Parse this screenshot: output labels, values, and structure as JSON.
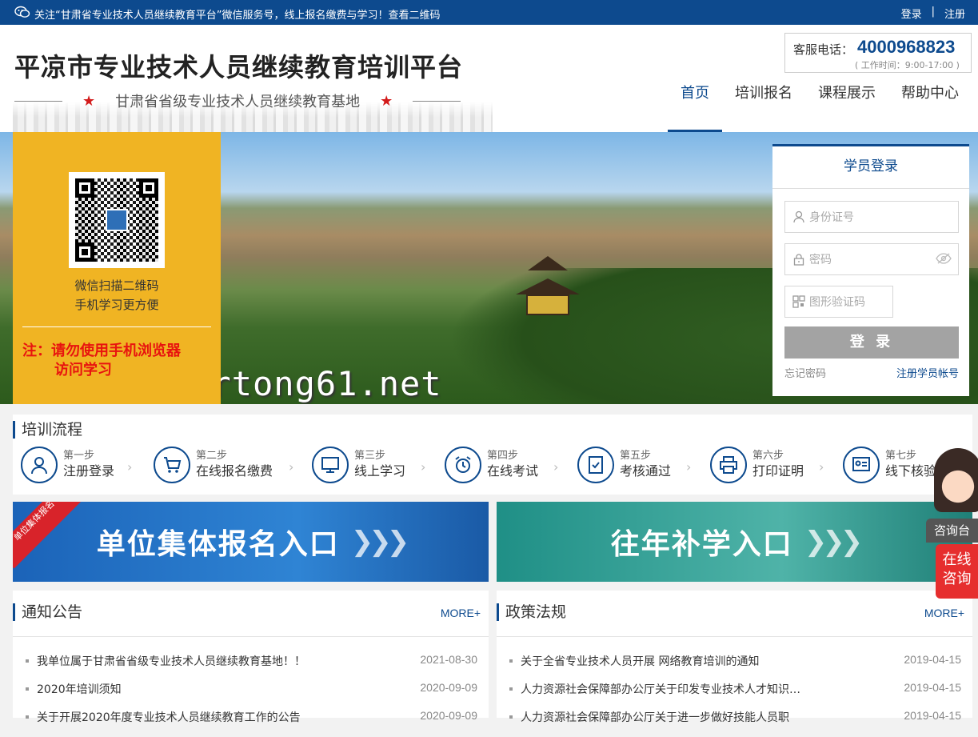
{
  "topbar": {
    "notice": "关注“甘肃省专业技术人员继续教育平台”微信服务号，线上报名缴费与学习！查看二维码",
    "login": "登录",
    "separator": "|",
    "register": "注册"
  },
  "header": {
    "title": "平凉市专业技术人员继续教育培训平台",
    "subtitle": "甘肃省省级专业技术人员继续教育基地",
    "service_label": "客服电话：",
    "service_phone": "4000968823",
    "service_hours": "( 工作时间：9:00-17:00 )"
  },
  "nav": [
    {
      "label": "首页",
      "active": true
    },
    {
      "label": "培训报名",
      "active": false
    },
    {
      "label": "课程展示",
      "active": false
    },
    {
      "label": "帮助中心",
      "active": false
    }
  ],
  "qr_panel": {
    "line1": "微信扫描二维码",
    "line2": "手机学习更方便",
    "warn1": "注：请勿使用手机浏览器",
    "warn2": "访问学习"
  },
  "watermark": "www.ertong61.net",
  "login": {
    "title": "学员登录",
    "id_placeholder": "身份证号",
    "password_placeholder": "密码",
    "captcha_placeholder": "图形验证码",
    "button": "登 录",
    "forgot": "忘记密码",
    "register": "注册学员帐号"
  },
  "process": {
    "title": "培训流程",
    "steps": [
      {
        "num": "第一步",
        "label": "注册登录",
        "icon": "user-icon"
      },
      {
        "num": "第二步",
        "label": "在线报名缴费",
        "icon": "cart-icon"
      },
      {
        "num": "第三步",
        "label": "线上学习",
        "icon": "monitor-icon"
      },
      {
        "num": "第四步",
        "label": "在线考试",
        "icon": "alarm-clock-icon"
      },
      {
        "num": "第五步",
        "label": "考核通过",
        "icon": "checklist-icon"
      },
      {
        "num": "第六步",
        "label": "打印证明",
        "icon": "printer-icon"
      },
      {
        "num": "第七步",
        "label": "线下核验",
        "icon": "certificate-icon"
      }
    ]
  },
  "entries": {
    "group": "单位集体报名入口",
    "group_ribbon": "单位集体报名",
    "makeup": "往年补学入口"
  },
  "notices": {
    "title": "通知公告",
    "more": "MORE+",
    "items": [
      {
        "title": "我单位属于甘肃省省级专业技术人员继续教育基地！！",
        "date": "2021-08-30"
      },
      {
        "title": "2020年培训须知",
        "date": "2020-09-09"
      },
      {
        "title": "关于开展2020年度专业技术人员继续教育工作的公告",
        "date": "2020-09-09"
      }
    ]
  },
  "policies": {
    "title": "政策法规",
    "more": "MORE+",
    "items": [
      {
        "title": "关于全省专业技术人员开展 网络教育培训的通知",
        "date": "2019-04-15"
      },
      {
        "title": "人力资源社会保障部办公厅关于印发专业技术人才知识…",
        "date": "2019-04-15"
      },
      {
        "title": "人力资源社会保障部办公厅关于进一步做好技能人员职",
        "date": "2019-04-15"
      }
    ]
  },
  "consult": {
    "label": "咨询台",
    "online1": "在线",
    "online2": "咨询"
  }
}
